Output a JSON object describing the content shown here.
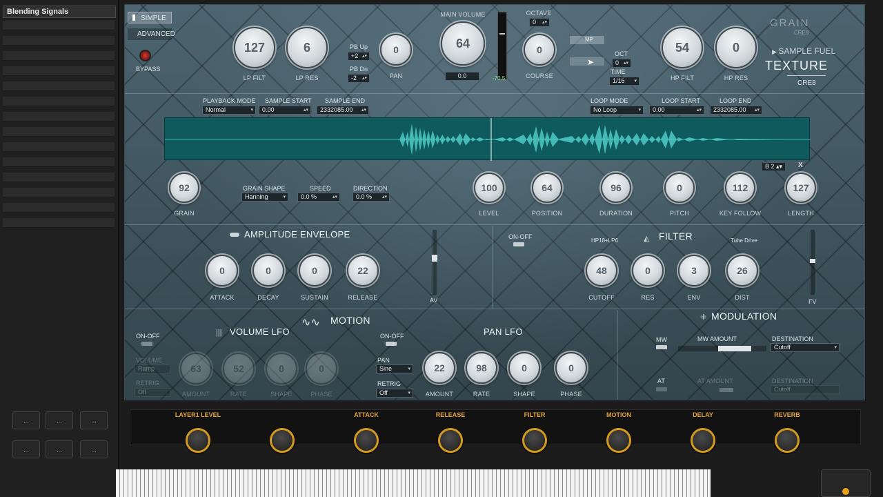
{
  "sidebar": {
    "title": "Blending Signals"
  },
  "mode": {
    "simple": "SIMPLE",
    "advanced": "ADVANCED",
    "bypass": "BYPASS"
  },
  "top": {
    "lp_filt": {
      "value": "127",
      "label": "LP FILT"
    },
    "lp_res": {
      "value": "6",
      "label": "LP RES"
    },
    "pb_up": {
      "label": "PB Up",
      "value": "+2"
    },
    "pb_dn": {
      "label": "PB Dn",
      "value": "-2"
    },
    "pan": {
      "value": "0",
      "label": "PAN"
    },
    "main_volume": {
      "label": "MAIN VOLUME",
      "value": "64",
      "readout": "0.0"
    },
    "meter_readout": "-70.5",
    "octave": {
      "label": "OCTAVE",
      "value": "0"
    },
    "course": {
      "value": "0",
      "label": "COURSE"
    },
    "mp": "MP",
    "oct": {
      "label": "OCT",
      "value": "0"
    },
    "time": {
      "label": "TIME",
      "value": "1/16"
    },
    "hp_filt": {
      "value": "54",
      "label": "HP FILT"
    },
    "hp_res": {
      "value": "0",
      "label": "HP RES"
    }
  },
  "brand": {
    "grain": "GRAIN",
    "cre8_small": "CRE8",
    "sample_fuel": "SAMPLE FUEL",
    "texture": "TEXTURE",
    "cre8": "CRE8"
  },
  "playback": {
    "playback_mode": {
      "label": "PLAYBACK MODE",
      "value": "Normal"
    },
    "sample_start": {
      "label": "SAMPLE START",
      "value": "0.00"
    },
    "sample_end": {
      "label": "SAMPLE END",
      "value": "2332085.00"
    },
    "loop_mode": {
      "label": "LOOP MODE",
      "value": "No Loop"
    },
    "loop_start": {
      "label": "LOOP START",
      "value": "0.00"
    },
    "loop_end": {
      "label": "LOOP END",
      "value": "2332085.00"
    }
  },
  "grain": {
    "grain": {
      "value": "92",
      "label": "GRAIN"
    },
    "grain_shape": {
      "label": "GRAIN SHAPE",
      "value": "Hanning"
    },
    "speed": {
      "label": "SPEED",
      "value": "0.0 %"
    },
    "direction": {
      "label": "DIRECTION",
      "value": "0.0 %"
    },
    "level": {
      "value": "100",
      "label": "LEVEL"
    },
    "position": {
      "value": "64",
      "label": "POSITION"
    },
    "duration": {
      "value": "96",
      "label": "DURATION"
    },
    "pitch": {
      "value": "0",
      "label": "PITCH"
    },
    "key_follow": {
      "value": "112",
      "label": "KEY FOLLOW"
    },
    "length": {
      "value": "127",
      "label": "LENGTH"
    },
    "note": "B 2",
    "close": "X"
  },
  "amp_env": {
    "title": "AMPLITUDE ENVELOPE",
    "attack": {
      "value": "0",
      "label": "ATTACK"
    },
    "decay": {
      "value": "0",
      "label": "DECAY"
    },
    "sustain": {
      "value": "0",
      "label": "SUSTAIN"
    },
    "release": {
      "value": "22",
      "label": "RELEASE"
    },
    "av": "AV"
  },
  "filter": {
    "title": "FILTER",
    "on_off": "ON-OFF",
    "type": "HP18+LP6",
    "drive": "Tube Drive",
    "cutoff": {
      "value": "48",
      "label": "CUTOFF"
    },
    "res": {
      "value": "0",
      "label": "RES"
    },
    "env": {
      "value": "3",
      "label": "ENV"
    },
    "dist": {
      "value": "26",
      "label": "DIST"
    },
    "fv": "FV"
  },
  "motion": {
    "title": "MOTION",
    "volume_lfo": {
      "title": "VOLUME LFO",
      "on_off": "ON-OFF",
      "volume_label": "VOLUME",
      "volume_value": "Ramp",
      "retrig_label": "RETRIG",
      "retrig_value": "Off",
      "knobs": [
        {
          "value": "63",
          "label": "AMOUNT"
        },
        {
          "value": "52",
          "label": "RATE"
        },
        {
          "value": "0",
          "label": "SHAPE"
        },
        {
          "value": "0",
          "label": "PHASE"
        }
      ]
    },
    "pan_lfo": {
      "title": "PAN LFO",
      "on_off": "ON-OFF",
      "pan_label": "PAN",
      "pan_value": "Sine",
      "retrig_label": "RETRIG",
      "retrig_value": "Off",
      "amount": {
        "value": "22",
        "label": "AMOUNT"
      },
      "rate": {
        "value": "98",
        "label": "RATE"
      },
      "shape": {
        "value": "0",
        "label": "SHAPE"
      },
      "phase": {
        "value": "0",
        "label": "PHASE"
      }
    }
  },
  "modulation": {
    "title": "MODULATION",
    "mw": "MW",
    "mw_amount": "MW AMOUNT",
    "destination": "DESTINATION",
    "dest_value": "Cutoff",
    "at": "AT",
    "at_amount": "AT AMOUNT",
    "at_destination": "DESTINATION",
    "at_dest_value": "Cutoff"
  },
  "macros": [
    {
      "label": "LAYER1 LEVEL"
    },
    {
      "label": ""
    },
    {
      "label": "ATTACK"
    },
    {
      "label": "RELEASE"
    },
    {
      "label": "FILTER"
    },
    {
      "label": "MOTION"
    },
    {
      "label": "DELAY"
    },
    {
      "label": "REVERB"
    }
  ],
  "left_buttons": [
    "...",
    "...",
    "...",
    "...",
    "...",
    "...",
    "..."
  ]
}
